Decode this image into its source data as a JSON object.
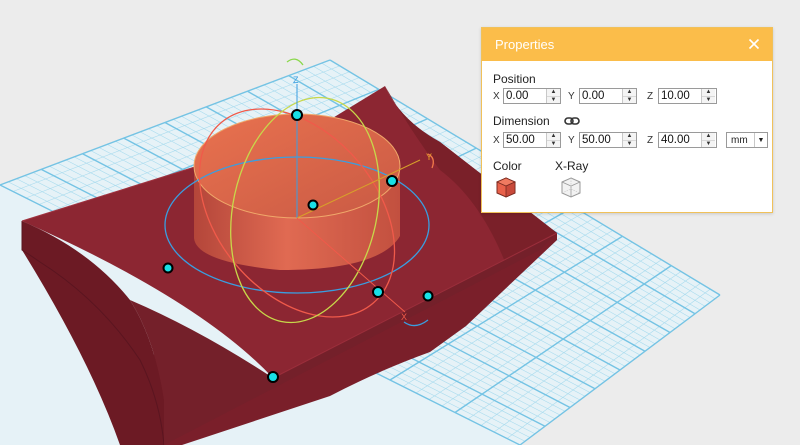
{
  "properties_panel": {
    "title": "Properties",
    "position": {
      "label": "Position",
      "x_label": "X",
      "x_value": "0.00",
      "y_label": "Y",
      "y_value": "0.00",
      "z_label": "Z",
      "z_value": "10.00"
    },
    "dimension": {
      "label": "Dimension",
      "x_label": "X",
      "x_value": "50.00",
      "y_label": "Y",
      "y_value": "50.00",
      "z_label": "Z",
      "z_value": "40.00",
      "unit": "mm"
    },
    "color_label": "Color",
    "xray_label": "X-Ray",
    "color_value": "#e8614a"
  },
  "gizmo": {
    "z_axis_label": "Z",
    "y_axis_label": "Y",
    "x_axis_label": "X"
  },
  "colors": {
    "accent": "#fbbd4a",
    "grid": "#8fd0ea",
    "base_block": "#8a2630",
    "cylinder": "#d9604a",
    "handle": "#18e0e6",
    "ring_blue": "#3a9ee0",
    "ring_red": "#f05a4a",
    "ring_green": "#c8d84a"
  }
}
